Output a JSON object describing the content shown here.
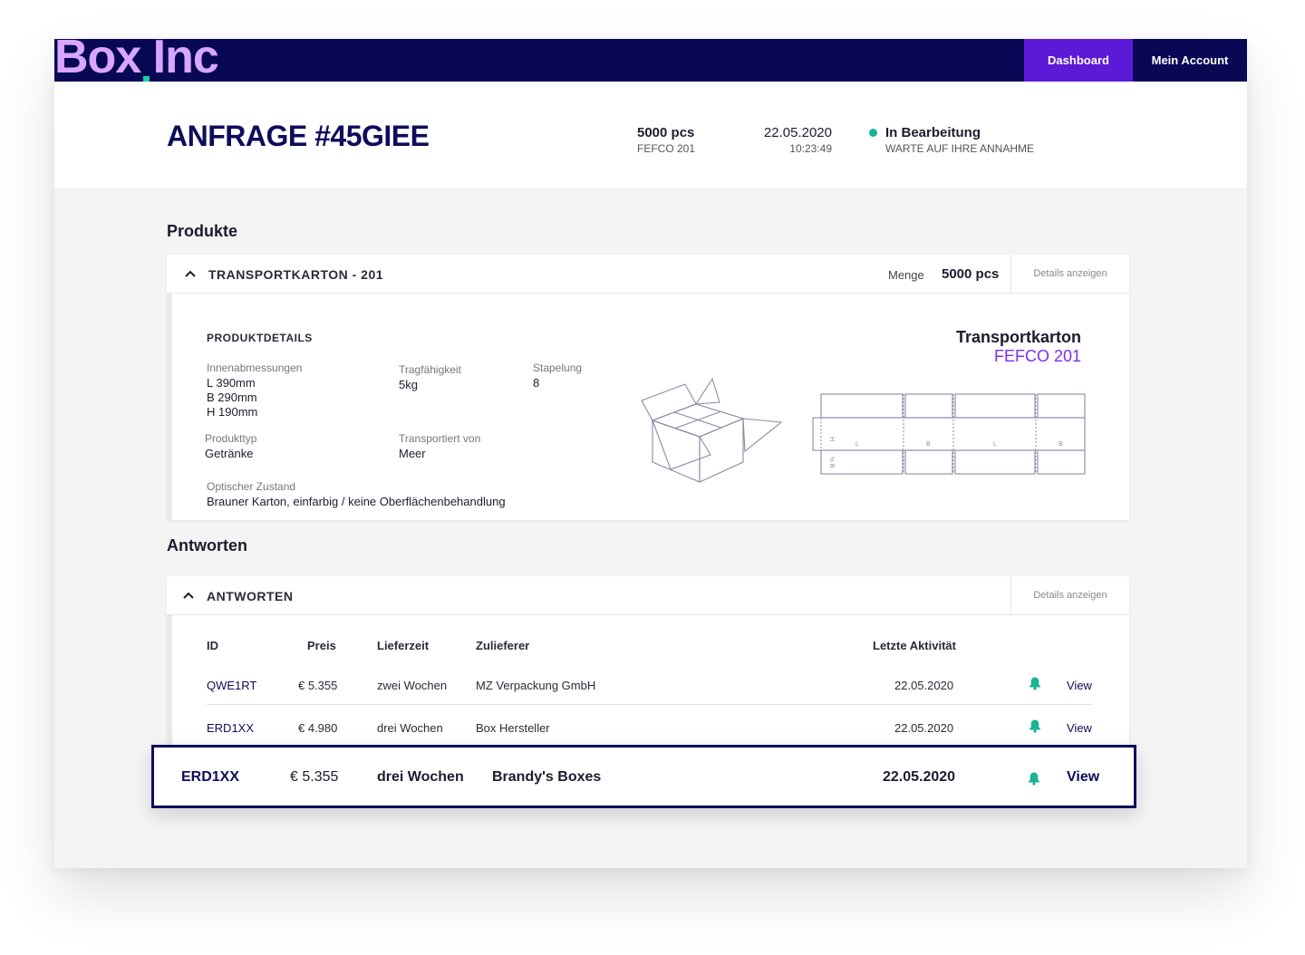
{
  "app": {
    "logo": "Box Inc",
    "nav": {
      "dashboard": "Dashboard",
      "account": "Mein Account"
    }
  },
  "request": {
    "title": "ANFRAGE #45GIEE",
    "quantity": "5000 pcs",
    "product_code": "FEFCO 201",
    "date": "22.05.2020",
    "time": "10:23:49",
    "status": "In Bearbeitung",
    "status_sub": "WARTE AUF IHRE ANNAHME"
  },
  "colors": {
    "brand_dark": "#080855",
    "accent_purple": "#5b1ad6",
    "status_green": "#1ab394",
    "logo_lilac": "#d8a6ff"
  },
  "products": {
    "section_title": "Produkte",
    "card_title": "TRANSPORTKARTON - 201",
    "qty_label": "Menge",
    "qty_value": "5000 pcs",
    "details_link": "Details anzeigen",
    "details_title": "PRODUKTDETAILS",
    "inner_dims_label": "Innenabmessungen",
    "dim_l": "L 390mm",
    "dim_b": "B 290mm",
    "dim_h": "H 190mm",
    "load_label": "Tragfähigkeit",
    "load_value": "5kg",
    "stack_label": "Stapelung",
    "stack_value": "8",
    "type_label": "Produkttyp",
    "type_value": "Getränke",
    "transport_label": "Transportiert von",
    "transport_value": "Meer",
    "condition_label": "Optischer Zustand",
    "condition_value": "Brauner Karton, einfarbig / keine Oberflächenbehandlung",
    "box_name": "Transportkarton",
    "box_code": "FEFCO 201",
    "diagram_labels": {
      "h": "H",
      "l": "L",
      "b": "B",
      "hb": "½ B"
    }
  },
  "answers": {
    "section_title": "Antworten",
    "card_title": "ANTWORTEN",
    "details_link": "Details anzeigen",
    "columns": {
      "id": "ID",
      "price": "Preis",
      "delivery": "Lieferzeit",
      "supplier": "Zulieferer",
      "activity": "Letzte Aktivität"
    },
    "rows": [
      {
        "id": "QWE1RT",
        "price": "€ 5.355",
        "delivery": "zwei Wochen",
        "supplier": "MZ Verpackung GmbH",
        "activity": "22.05.2020",
        "action": "View"
      },
      {
        "id": "ERD1XX",
        "price": "€ 4.980",
        "delivery": "drei Wochen",
        "supplier": "Box Hersteller",
        "activity": "22.05.2020",
        "action": "View"
      }
    ],
    "highlighted": {
      "id": "ERD1XX",
      "price": "€ 5.355",
      "delivery": "drei Wochen",
      "supplier": "Brandy's Boxes",
      "activity": "22.05.2020",
      "action": "View"
    }
  },
  "icons": {
    "bell": "bell-icon",
    "chevron": "chevron-up-icon",
    "status": "status-dot-icon"
  }
}
